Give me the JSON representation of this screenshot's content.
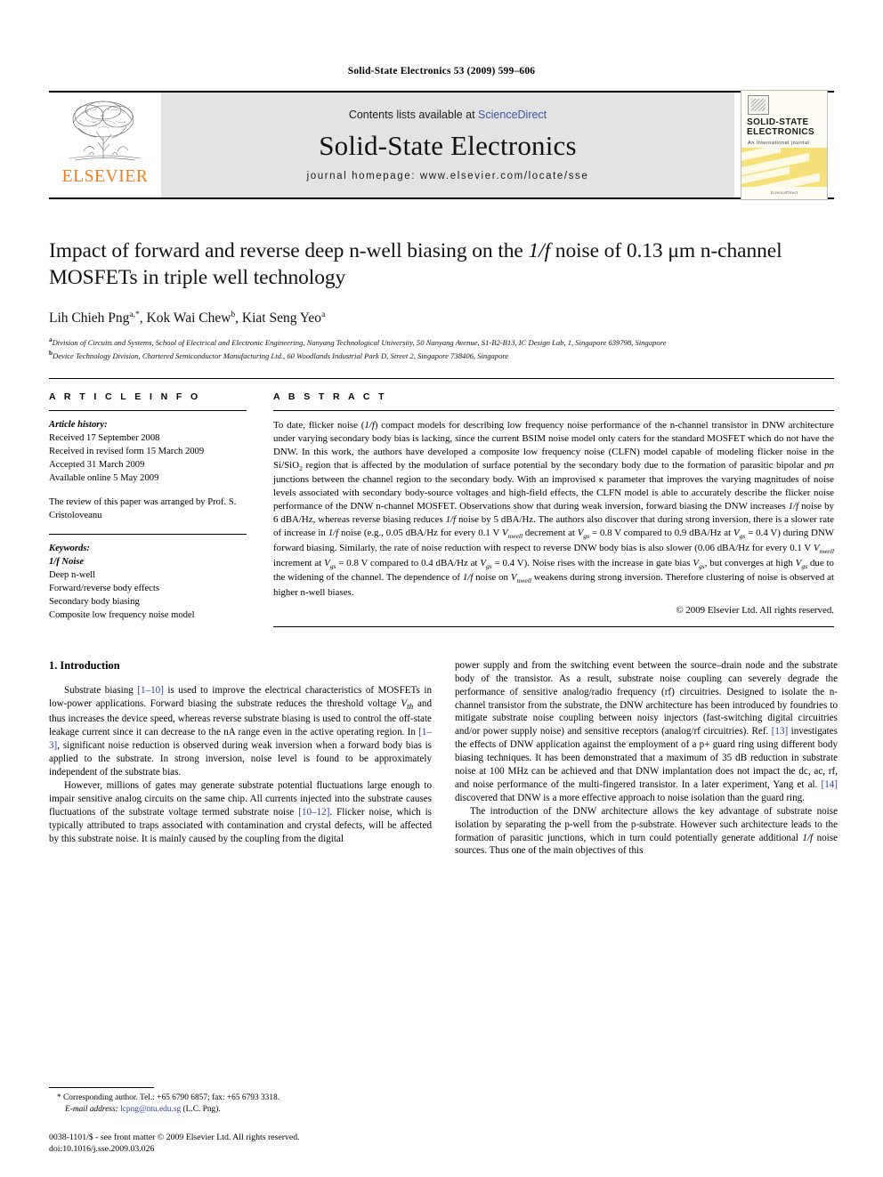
{
  "running_head": "Solid-State Electronics 53 (2009) 599–606",
  "masthead": {
    "publisher_name": "ELSEVIER",
    "contents_prefix": "Contents lists available at ",
    "contents_link": "ScienceDirect",
    "journal_title": "Solid-State Electronics",
    "homepage": "journal homepage: www.elsevier.com/locate/sse",
    "cover": {
      "title_line1": "SOLID-STATE",
      "title_line2": "ELECTRONICS",
      "subtitle": "An international journal",
      "footer": "ScienceDirect"
    }
  },
  "article": {
    "title_part1": "Impact of forward and reverse deep n-well biasing on the ",
    "title_italic": "1/f",
    "title_part2": " noise of 0.13 μm n-channel MOSFETs in triple well technology",
    "authors": "Lih Chieh Png a,*, Kok Wai Chew b, Kiat Seng Yeo a",
    "author1": "Lih Chieh Png",
    "author1_sup": "a,*",
    "author2": "Kok Wai Chew",
    "author2_sup": "b",
    "author3": "Kiat Seng Yeo",
    "author3_sup": "a",
    "affiliation_a_sup": "a",
    "affiliation_a": "Division of Circuits and Systems, School of Electrical and Electronic Engineering, Nanyang Technological University, 50 Nanyang Avenue, S1-B2-B13, IC Design Lab, 1, Singapore 639798, Singapore",
    "affiliation_b_sup": "b",
    "affiliation_b": "Device Technology Division, Chartered Semiconductor Manufacturing Ltd., 60 Woodlands Industrial Park D, Street 2, Singapore 738406, Singapore"
  },
  "article_info": {
    "heading": "A R T I C L E   I N F O",
    "history_label": "Article history:",
    "history": [
      "Received 17 September 2008",
      "Received in revised form 15 March 2009",
      "Accepted 31 March 2009",
      "Available online 5 May 2009"
    ],
    "editor_note": "The review of this paper was arranged by Prof. S. Cristoloveanu",
    "keywords_label": "Keywords:",
    "keywords": [
      "1/f Noise",
      "Deep n-well",
      "Forward/reverse body effects",
      "Secondary body biasing",
      "Composite low frequency noise model"
    ]
  },
  "abstract": {
    "heading": "A B S T R A C T",
    "p1_a": "To date, flicker noise (",
    "p1_it1": "1/f",
    "p1_b": ") compact models for describing low frequency noise performance of the n-channel transistor in DNW architecture under varying secondary body bias is lacking, since the current BSIM noise model only caters for the standard MOSFET which do not have the DNW. In this work, the authors have developed a composite low frequency noise (CLFN) model capable of modeling flicker noise in the Si/SiO",
    "p1_sub1": "2",
    "p1_c": " region that is affected by the modulation of surface potential by the secondary body due to the formation of parasitic bipolar and ",
    "p1_it2": "pn",
    "p1_d": " junctions between the channel region to the secondary body. With an improvised κ parameter that improves the varying magnitudes of noise levels associated with secondary body-source voltages and high-field effects, the CLFN model is able to accurately describe the flicker noise performance of the DNW n-channel MOSFET. Observations show that during weak inversion, forward biasing the DNW increases ",
    "p1_it3": "1/f",
    "p1_e": " noise by 6 dBA/Hz, whereas reverse biasing reduces ",
    "p1_it4": "1/f",
    "p1_f": " noise by 5 dBA/Hz. The authors also discover that during strong inversion, there is a slower rate of increase in ",
    "p1_it5": "1/f",
    "p1_g": " noise (e.g., 0.05 dBA/Hz for every 0.1 V ",
    "p1_v1": "V",
    "p1_v1sub": "nwell",
    "p1_h": " decrement at ",
    "p1_v2": "V",
    "p1_v2sub": "gs",
    "p1_i": " = 0.8 V compared to 0.9 dBA/Hz at ",
    "p1_v3": "V",
    "p1_v3sub": "gs",
    "p1_j": " = 0.4 V) during DNW forward biasing. Similarly, the rate of noise reduction with respect to reverse DNW body bias is also slower (0.06 dBA/Hz for every 0.1 V ",
    "p1_v4": "V",
    "p1_v4sub": "nwell",
    "p1_k": " increment at ",
    "p1_v5": "V",
    "p1_v5sub": "gs",
    "p1_l": " = 0.8 V compared to 0.4 dBA/Hz at ",
    "p1_v6": "V",
    "p1_v6sub": "gs",
    "p1_m": " = 0.4 V). Noise rises with the increase in gate bias ",
    "p1_v7": "V",
    "p1_v7sub": "gs",
    "p1_n": ", but converges at high ",
    "p1_v8": "V",
    "p1_v8sub": "gs",
    "p1_o": " due to the widening of the channel. The dependence of ",
    "p1_it6": "1/f",
    "p1_p": " noise on ",
    "p1_v9": "V",
    "p1_v9sub": "nwell",
    "p1_q": " weakens during strong inversion. Therefore clustering of noise is observed at higher n-well biases.",
    "copyright": "© 2009 Elsevier Ltd. All rights reserved."
  },
  "introduction": {
    "heading": "1. Introduction",
    "left_p1_a": "Substrate biasing ",
    "left_p1_ref1": "[1–10]",
    "left_p1_b": " is used to improve the electrical characteristics of MOSFETs in low-power applications. Forward biasing the substrate reduces the threshold voltage ",
    "left_p1_v1": "V",
    "left_p1_v1sub": "th",
    "left_p1_c": " and thus increases the device speed, whereas reverse substrate biasing is used to control the off-state leakage current since it can decrease to the nA range even in the active operating region. In ",
    "left_p1_ref2": "[1–3]",
    "left_p1_d": ", significant noise reduction is observed during weak inversion when a forward body bias is applied to the substrate. In strong inversion, noise level is found to be approximately independent of the substrate bias.",
    "left_p2_a": "However, millions of gates may generate substrate potential fluctuations large enough to impair sensitive analog circuits on the same chip. All currents injected into the substrate causes fluctuations of the substrate voltage termed substrate noise ",
    "left_p2_ref1": "[10–12]",
    "left_p2_b": ". Flicker noise, which is typically attributed to traps associated with contamination and crystal defects, will be affected by this substrate noise. It is mainly caused by the coupling from the digital",
    "right_p1_a": "power supply and from the switching event between the source–drain node and the substrate body of the transistor. As a result, substrate noise coupling can severely degrade the performance of sensitive analog/radio frequency (rf) circuitries. Designed to isolate the n-channel transistor from the substrate, the DNW architecture has been introduced by foundries to mitigate substrate noise coupling between noisy injectors (fast-switching digital circuitries and/or power supply noise) and sensitive receptors (analog/rf circuitries). Ref. ",
    "right_p1_ref1": "[13]",
    "right_p1_b": " investigates the effects of DNW application against the employment of a p+ guard ring using different body biasing techniques. It has been demonstrated that a maximum of 35 dB reduction in substrate noise at 100 MHz can be achieved and that DNW implantation does not impact the dc, ac, rf, and noise performance of the multi-fingered transistor. In a later experiment, Yang et al. ",
    "right_p1_ref2": "[14]",
    "right_p1_c": " discovered that DNW is a more effective approach to noise isolation than the guard ring.",
    "right_p2_a": "The introduction of the DNW architecture allows the key advantage of substrate noise isolation by separating the p-well from the p-substrate. However such architecture leads to the formation of parasitic junctions, which in turn could potentially generate additional ",
    "right_p2_it1": "1/f",
    "right_p2_b": " noise sources. Thus one of the main objectives of this"
  },
  "footnotes": {
    "star": "*",
    "corresponding": " Corresponding author. Tel.: +65 6790 6857; fax: +65 6793 3318.",
    "email_label": "E-mail address:",
    "email": "lcpng@ntu.edu.sg",
    "email_suffix": " (L.C. Png).",
    "issn_line": "0038-1101/$ - see front matter © 2009 Elsevier Ltd. All rights reserved.",
    "doi_line": "doi:10.1016/j.sse.2009.03.026"
  },
  "colors": {
    "link_blue": "#3a53a4",
    "ref_blue": "#2b3f9e",
    "elsevier_orange": "#f07c1b",
    "masthead_gray": "#e3e3e3",
    "cover_yellow": "#f5e07a"
  }
}
